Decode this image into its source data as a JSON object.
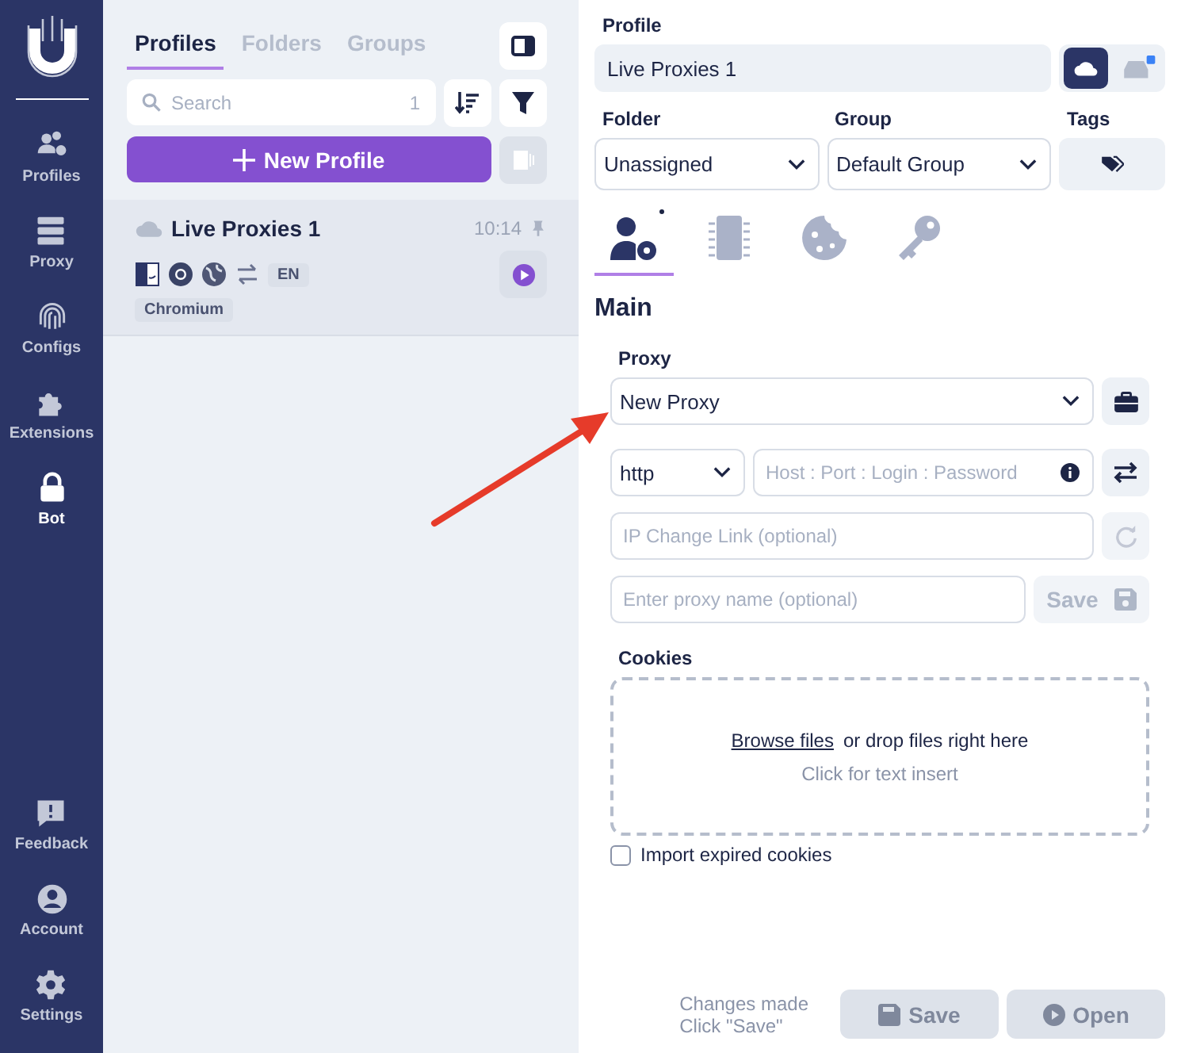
{
  "sidebar": {
    "top_items": [
      {
        "label": "Profiles",
        "selected": false
      },
      {
        "label": "Proxy",
        "selected": false
      },
      {
        "label": "Configs",
        "selected": false
      },
      {
        "label": "Extensions",
        "selected": false
      },
      {
        "label": "Bot",
        "selected": true
      }
    ],
    "bottom_items": [
      {
        "label": "Feedback",
        "selected": false
      },
      {
        "label": "Account",
        "selected": false
      },
      {
        "label": "Settings",
        "selected": false
      }
    ]
  },
  "list_panel": {
    "tabs": [
      {
        "label": "Profiles",
        "selected": true
      },
      {
        "label": "Folders",
        "selected": false
      },
      {
        "label": "Groups",
        "selected": false
      }
    ],
    "search": {
      "placeholder": "Search",
      "count": "1"
    },
    "new_profile_button": "New Profile",
    "profiles": [
      {
        "name": "Live Proxies 1",
        "time": "10:14",
        "language": "EN",
        "browser": "Chromium"
      }
    ]
  },
  "editor": {
    "profile_label": "Profile",
    "profile_name": "Live Proxies 1",
    "storage": [
      {
        "kind": "cloud",
        "selected": true
      },
      {
        "kind": "local",
        "selected": false
      }
    ],
    "folder_label": "Folder",
    "folder": "Unassigned",
    "group_label": "Group",
    "group": "Default Group",
    "tags_label": "Tags",
    "tabs": [
      {
        "selected": true,
        "modified": true
      },
      {
        "selected": false,
        "modified": false
      },
      {
        "selected": false,
        "modified": false
      },
      {
        "selected": false,
        "modified": false
      }
    ],
    "section_title": "Main",
    "proxy_label": "Proxy",
    "proxy": "New Proxy",
    "protocol": "http",
    "host_placeholder": "Host : Port : Login : Password",
    "ip_change_placeholder": "IP Change Link (optional)",
    "proxy_name_placeholder": "Enter proxy name (optional)",
    "save_proxy_button": {
      "label": "Save",
      "disabled": true
    },
    "cookies_label": "Cookies",
    "browse_link": "Browse files",
    "drop_text": "or drop files right here",
    "insert_hint": "Click for text insert",
    "import_expired": {
      "label": "Import expired cookies",
      "checked": false
    }
  },
  "footer": {
    "status": [
      "Changes made",
      "Click \"Save\""
    ],
    "save_button": {
      "label": "Save",
      "disabled": true
    },
    "open_button": {
      "label": "Open",
      "disabled": true
    }
  }
}
